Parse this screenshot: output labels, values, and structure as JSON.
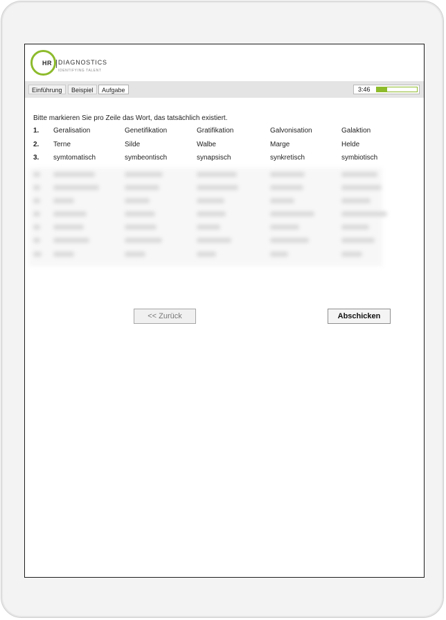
{
  "logo": {
    "initials": "HR",
    "name": "DIAGNOSTICS",
    "tagline": "IDENTIFYING TALENT",
    "brand_color": "#8dbb2c"
  },
  "tabs": [
    {
      "label": "Einführung",
      "active": false
    },
    {
      "label": "Beispiel",
      "active": false
    },
    {
      "label": "Aufgabe",
      "active": true
    }
  ],
  "timer": {
    "time": "3:46",
    "progress_fraction": 0.25
  },
  "instruction": "Bitte markieren Sie pro Zeile das Wort, das tatsächlich existiert.",
  "rows": [
    {
      "number": "1.",
      "words": [
        "Geralisation",
        "Genetifikation",
        "Gratifikation",
        "Galvonisation",
        "Galaktion"
      ]
    },
    {
      "number": "2.",
      "words": [
        "Terne",
        "Silde",
        "Walbe",
        "Marge",
        "Helde"
      ]
    },
    {
      "number": "3.",
      "words": [
        "symtomatisch",
        "symbeontisch",
        "synapsisch",
        "synkretisch",
        "symbiotisch"
      ]
    }
  ],
  "buttons": {
    "back": "<< Zurück",
    "submit": "Abschicken"
  }
}
